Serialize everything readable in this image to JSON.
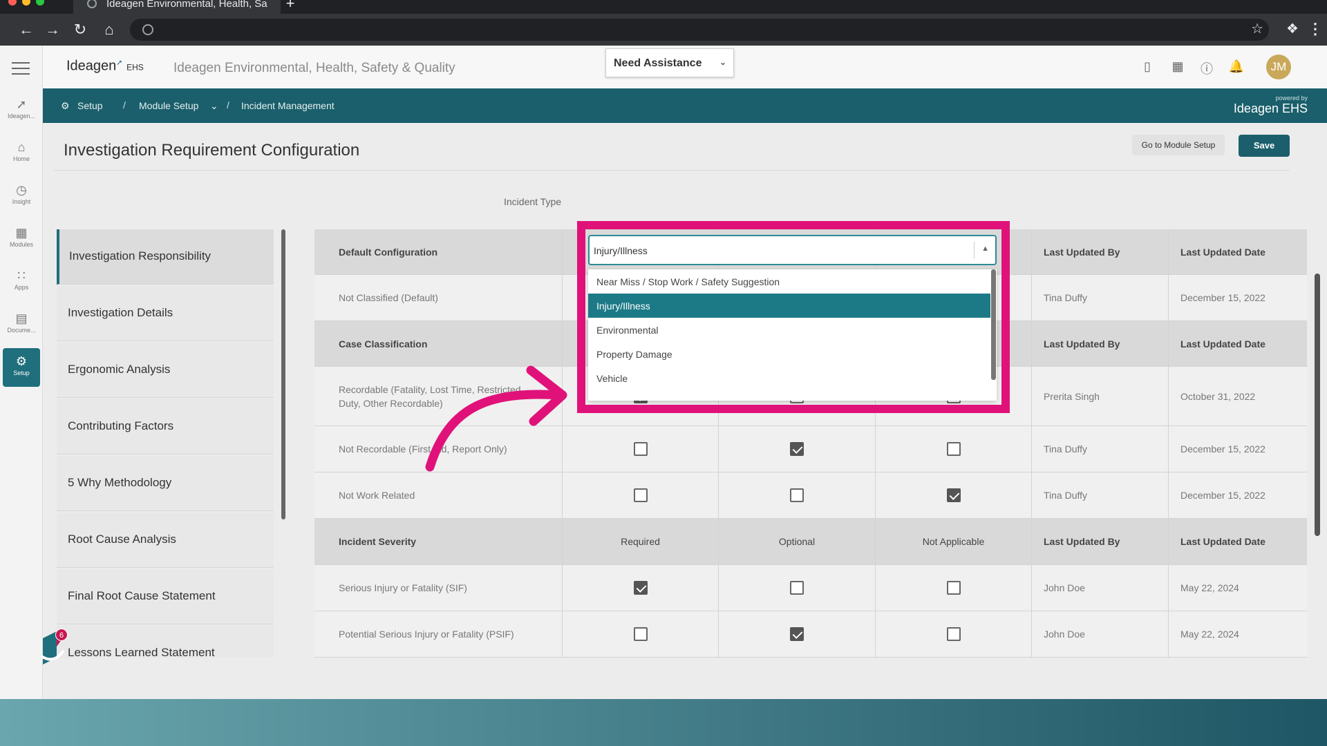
{
  "browser": {
    "tab_title": "Ideagen Environmental, Health, Sa",
    "new_tab": "+",
    "omnibox_url": ""
  },
  "header": {
    "logo_text": "Ideagen",
    "logo_suffix": "EHS",
    "app_title": "Ideagen Environmental, Health, Safety & Quality",
    "assist_label": "Need Assistance",
    "avatar_initials": "JM"
  },
  "leftnav": {
    "items": [
      {
        "label": "Ideagen...",
        "icon": "ideagen-icon"
      },
      {
        "label": "Home",
        "icon": "home-icon"
      },
      {
        "label": "Insight",
        "icon": "insight-icon"
      },
      {
        "label": "Modules",
        "icon": "modules-icon"
      },
      {
        "label": "Apps",
        "icon": "apps-icon"
      },
      {
        "label": "Docume...",
        "icon": "document-icon"
      },
      {
        "label": "Setup",
        "icon": "gear-icon"
      }
    ]
  },
  "breadcrumb": {
    "setup": "Setup",
    "sep": "/",
    "module_setup": "Module Setup",
    "incident_management": "Incident Management",
    "powered_small": "powered by",
    "powered_big": "Ideagen EHS"
  },
  "page": {
    "title": "Investigation Requirement Configuration",
    "go_to_module_setup": "Go to Module Setup",
    "save": "Save",
    "incident_type_label": "Incident Type",
    "badge_count": "6"
  },
  "sidemenu": [
    "Investigation Responsibility",
    "Investigation Details",
    "Ergonomic Analysis",
    "Contributing Factors",
    "5 Why Methodology",
    "Root Cause Analysis",
    "Final Root Cause Statement",
    "Lessons Learned Statement"
  ],
  "dropdown": {
    "value": "Injury/Illness",
    "options": [
      "Near Miss / Stop Work / Safety Suggestion",
      "Injury/Illness",
      "Environmental",
      "Property Damage",
      "Vehicle"
    ]
  },
  "table": {
    "sections": [
      {
        "header": [
          "Default Configuration",
          "",
          "",
          "",
          "Last Updated By",
          "Last Updated Date"
        ],
        "rows": [
          {
            "label": "Not Classified (Default)",
            "checks": [
              null,
              null,
              null
            ],
            "by": "Tina Duffy",
            "date": "December 15, 2022"
          }
        ]
      },
      {
        "header": [
          "Case Classification",
          "",
          "",
          "",
          "Last Updated By",
          "Last Updated Date"
        ],
        "rows": [
          {
            "label": "Recordable (Fatality, Lost Time, Restricted Duty, Other Recordable)",
            "checks": [
              true,
              false,
              false
            ],
            "by": "Prerita Singh",
            "date": "October 31, 2022"
          },
          {
            "label": "Not Recordable (First Aid, Report Only)",
            "checks": [
              false,
              true,
              false
            ],
            "by": "Tina Duffy",
            "date": "December 15, 2022"
          },
          {
            "label": "Not Work Related",
            "checks": [
              false,
              false,
              true
            ],
            "by": "Tina Duffy",
            "date": "December 15, 2022"
          }
        ]
      },
      {
        "header": [
          "Incident Severity",
          "Required",
          "Optional",
          "Not Applicable",
          "Last Updated By",
          "Last Updated Date"
        ],
        "rows": [
          {
            "label": "Serious Injury or Fatality (SIF)",
            "checks": [
              true,
              false,
              false
            ],
            "by": "John Doe",
            "date": "May 22, 2024"
          },
          {
            "label": "Potential Serious Injury or Fatality (PSIF)",
            "checks": [
              false,
              true,
              false
            ],
            "by": "John Doe",
            "date": "May 22, 2024"
          }
        ]
      }
    ]
  },
  "colors": {
    "brand_teal": "#1a5f6b",
    "highlight": "#e0127a",
    "selected_option": "#1c7a87"
  }
}
